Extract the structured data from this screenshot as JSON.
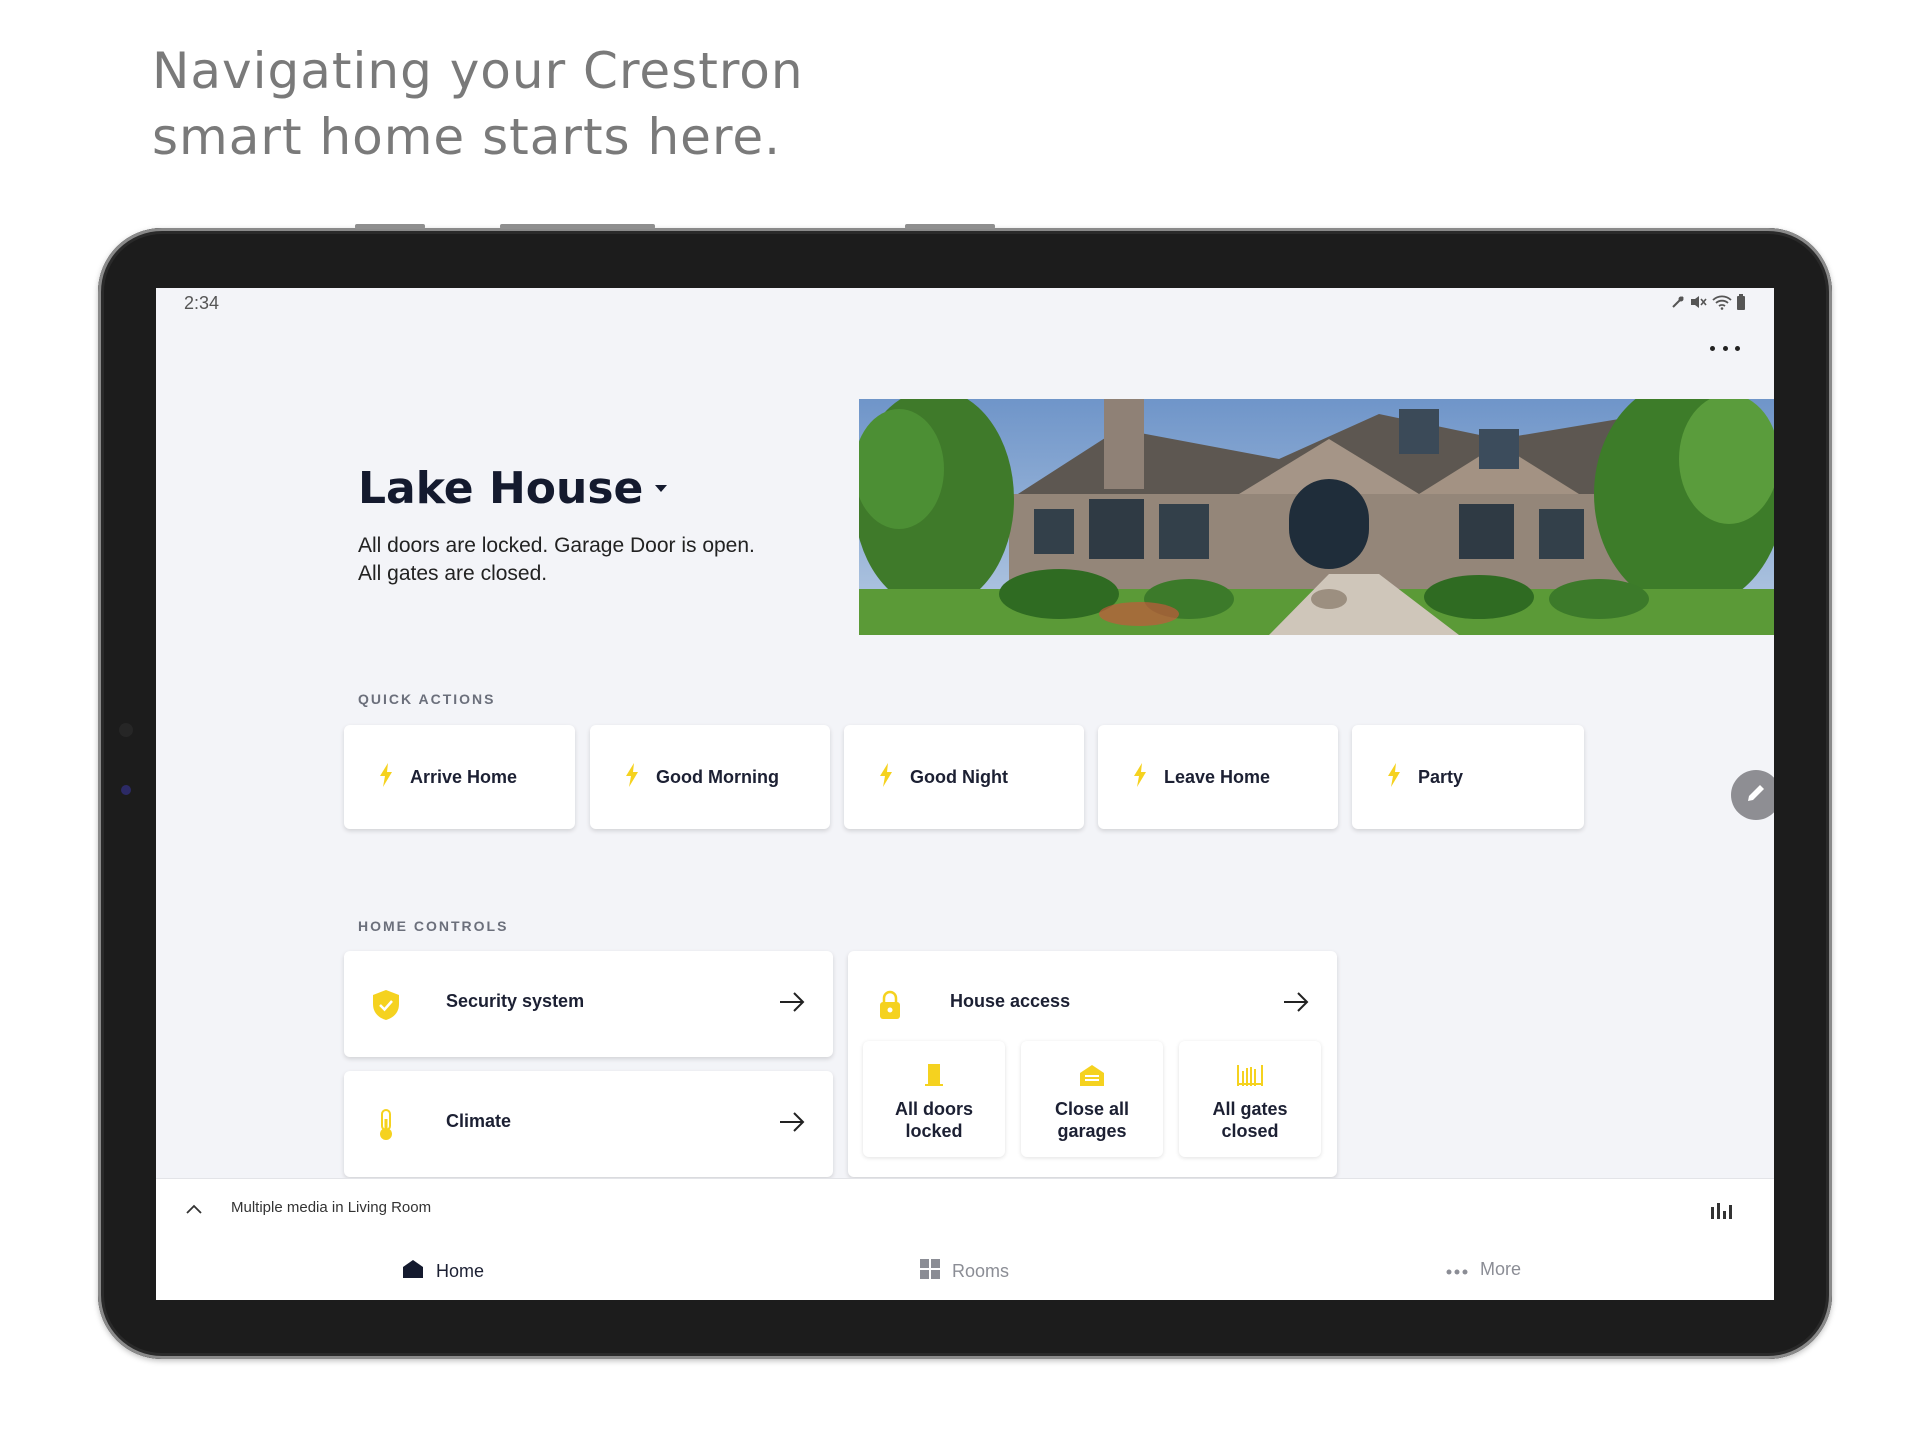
{
  "headline": {
    "line1": "Navigating your Crestron",
    "line2": "smart home starts here."
  },
  "status_bar": {
    "time": "2:34",
    "icons": [
      "mute-icon",
      "volume-off-icon",
      "wifi-icon",
      "battery-icon"
    ]
  },
  "home": {
    "title": "Lake House",
    "status_line1": "All doors are locked. Garage Door is open.",
    "status_line2": "All gates are closed."
  },
  "quick_actions": {
    "label": "QUICK ACTIONS",
    "items": [
      {
        "label": "Arrive Home"
      },
      {
        "label": "Good Morning"
      },
      {
        "label": "Good Night"
      },
      {
        "label": "Leave Home"
      },
      {
        "label": "Party"
      }
    ]
  },
  "home_controls": {
    "label": "HOME CONTROLS",
    "security": {
      "label": "Security system"
    },
    "climate": {
      "label": "Climate"
    },
    "house_access": {
      "label": "House access",
      "tiles": [
        {
          "line1": "All doors",
          "line2": "locked"
        },
        {
          "line1": "Close all",
          "line2": "garages"
        },
        {
          "line1": "All gates",
          "line2": "closed"
        }
      ]
    }
  },
  "media_bar": {
    "text": "Multiple media in Living Room"
  },
  "nav": {
    "home": "Home",
    "rooms": "Rooms",
    "more": "More"
  },
  "colors": {
    "accent_yellow": "#f5d21f",
    "title_dark": "#141a2e",
    "screen_bg": "#f3f4f8",
    "device_frame": "#1c1c1c"
  }
}
